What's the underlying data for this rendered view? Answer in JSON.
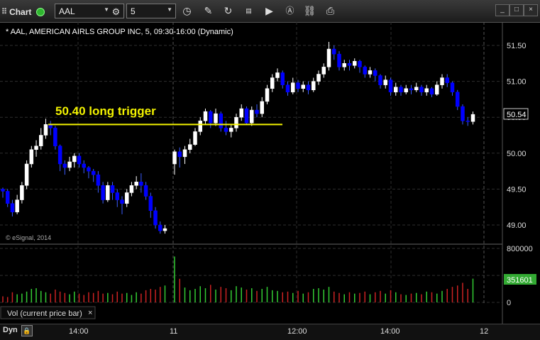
{
  "toolbar": {
    "title": "Chart",
    "symbol": "AAL",
    "interval": "5",
    "icons": [
      "clock-icon",
      "pencil-icon",
      "redraw-icon",
      "ticker-icon",
      "play-icon",
      "text-icon",
      "link-icon",
      "camera-icon"
    ],
    "window_buttons": [
      "minimize",
      "maximize",
      "close"
    ]
  },
  "chart": {
    "header": "* AAL, AMERICAN AIRLS GROUP INC, 5, 09:30-16:00 (Dynamic)",
    "watermark": "© eSignal, 2014",
    "annotation": "50.40 long trigger",
    "price_ticks": [
      "51.50",
      "51.00",
      "50.50",
      "50.00",
      "49.50",
      "49.00"
    ],
    "last_price": "50.54",
    "trigger_price": 50.4,
    "volume_ticks": [
      "800000",
      "400000",
      "0"
    ],
    "last_volume": "351601",
    "volume_label": "Vol (current price bar)",
    "close_symbol": "×",
    "colors": {
      "up": "#ffffff",
      "down": "#0000ff",
      "trigger": "#f2f200",
      "vol_up": "#33cc33",
      "vol_down": "#cc2222",
      "last_volume_bg": "#33aa33",
      "accent": "#555555"
    }
  },
  "chart_data": {
    "type": "candlestick",
    "x_tick_labels": [
      "14:00",
      "11",
      "12:00",
      "14:00",
      "12"
    ],
    "ylim": [
      48.82,
      51.73
    ],
    "volume_ylim": [
      0,
      800000
    ],
    "candles": [
      [
        49.5,
        49.47,
        49.52,
        49.38
      ],
      [
        49.47,
        49.3,
        49.5,
        49.25
      ],
      [
        49.3,
        49.18,
        49.35,
        49.12
      ],
      [
        49.18,
        49.35,
        49.42,
        49.15
      ],
      [
        49.35,
        49.55,
        49.6,
        49.3
      ],
      [
        49.55,
        49.85,
        49.9,
        49.5
      ],
      [
        49.85,
        50.05,
        50.1,
        49.8
      ],
      [
        50.05,
        50.1,
        50.18,
        49.95
      ],
      [
        50.1,
        50.25,
        50.35,
        50.05
      ],
      [
        50.25,
        50.4,
        50.48,
        50.2
      ],
      [
        50.4,
        50.35,
        50.45,
        50.25
      ],
      [
        50.35,
        50.1,
        50.38,
        50.05
      ],
      [
        50.1,
        49.85,
        50.12,
        49.75
      ],
      [
        49.85,
        49.8,
        49.9,
        49.7
      ],
      [
        49.8,
        49.88,
        49.95,
        49.75
      ],
      [
        49.88,
        49.96,
        50.0,
        49.8
      ],
      [
        49.96,
        49.85,
        50.0,
        49.8
      ],
      [
        49.85,
        49.8,
        49.9,
        49.72
      ],
      [
        49.8,
        49.75,
        49.82,
        49.65
      ],
      [
        49.75,
        49.7,
        49.78,
        49.6
      ],
      [
        49.7,
        49.55,
        49.75,
        49.45
      ],
      [
        49.55,
        49.35,
        49.6,
        49.3
      ],
      [
        49.35,
        49.55,
        49.6,
        49.32
      ],
      [
        49.55,
        49.45,
        49.6,
        49.35
      ],
      [
        49.45,
        49.35,
        49.5,
        49.25
      ],
      [
        49.35,
        49.3,
        49.4,
        49.15
      ],
      [
        49.3,
        49.45,
        49.5,
        49.25
      ],
      [
        49.45,
        49.55,
        49.6,
        49.4
      ],
      [
        49.55,
        49.6,
        49.68,
        49.5
      ],
      [
        49.6,
        49.55,
        49.72,
        49.45
      ],
      [
        49.55,
        49.4,
        49.6,
        49.35
      ],
      [
        49.4,
        49.2,
        49.45,
        49.1
      ],
      [
        49.2,
        49.0,
        49.25,
        48.95
      ],
      [
        49.0,
        48.92,
        49.05,
        48.88
      ],
      [
        48.92,
        48.95,
        49.0,
        48.88
      ],
      [
        49.85,
        50.02,
        50.05,
        49.7
      ],
      [
        50.02,
        49.95,
        50.08,
        49.8
      ],
      [
        49.95,
        50.05,
        50.1,
        49.85
      ],
      [
        50.05,
        50.12,
        50.2,
        50.0
      ],
      [
        50.12,
        50.3,
        50.35,
        50.1
      ],
      [
        50.3,
        50.45,
        50.5,
        50.25
      ],
      [
        50.45,
        50.58,
        50.62,
        50.4
      ],
      [
        50.58,
        50.42,
        50.6,
        50.35
      ],
      [
        50.42,
        50.55,
        50.62,
        50.38
      ],
      [
        50.55,
        50.35,
        50.58,
        50.3
      ],
      [
        50.35,
        50.3,
        50.45,
        50.25
      ],
      [
        50.3,
        50.35,
        50.4,
        50.22
      ],
      [
        50.35,
        50.5,
        50.55,
        50.3
      ],
      [
        50.5,
        50.62,
        50.68,
        50.45
      ],
      [
        50.62,
        50.42,
        50.65,
        50.4
      ],
      [
        50.42,
        50.6,
        50.65,
        50.38
      ],
      [
        50.6,
        50.55,
        50.68,
        50.5
      ],
      [
        50.55,
        50.72,
        50.78,
        50.5
      ],
      [
        50.72,
        50.9,
        50.95,
        50.68
      ],
      [
        50.9,
        51.05,
        51.1,
        50.85
      ],
      [
        51.05,
        51.12,
        51.18,
        51.0
      ],
      [
        51.12,
        50.95,
        51.15,
        50.9
      ],
      [
        50.95,
        50.85,
        51.0,
        50.8
      ],
      [
        50.85,
        50.98,
        51.05,
        50.82
      ],
      [
        50.98,
        50.9,
        51.02,
        50.85
      ],
      [
        50.9,
        50.95,
        51.0,
        50.85
      ],
      [
        50.95,
        50.88,
        51.0,
        50.82
      ],
      [
        50.88,
        51.0,
        51.05,
        50.85
      ],
      [
        51.0,
        51.1,
        51.15,
        50.95
      ],
      [
        51.1,
        51.2,
        51.25,
        51.05
      ],
      [
        51.2,
        51.45,
        51.55,
        51.15
      ],
      [
        51.45,
        51.38,
        51.5,
        51.3
      ],
      [
        51.38,
        51.2,
        51.42,
        51.15
      ],
      [
        51.2,
        51.25,
        51.3,
        51.15
      ],
      [
        51.25,
        51.22,
        51.3,
        51.15
      ],
      [
        51.22,
        51.28,
        51.32,
        51.18
      ],
      [
        51.28,
        51.2,
        51.3,
        51.12
      ],
      [
        51.2,
        51.1,
        51.22,
        51.05
      ],
      [
        51.1,
        51.15,
        51.2,
        51.05
      ],
      [
        51.15,
        51.08,
        51.18,
        51.0
      ],
      [
        51.08,
        50.95,
        51.1,
        50.9
      ],
      [
        50.95,
        51.02,
        51.08,
        50.9
      ],
      [
        51.02,
        50.85,
        51.05,
        50.8
      ],
      [
        50.85,
        50.92,
        50.98,
        50.8
      ],
      [
        50.92,
        50.85,
        50.95,
        50.8
      ],
      [
        50.85,
        50.9,
        50.95,
        50.82
      ],
      [
        50.9,
        50.88,
        50.95,
        50.82
      ],
      [
        50.88,
        50.92,
        50.98,
        50.85
      ],
      [
        50.92,
        50.85,
        50.95,
        50.8
      ],
      [
        50.85,
        50.9,
        50.95,
        50.8
      ],
      [
        50.9,
        50.82,
        50.92,
        50.78
      ],
      [
        50.82,
        50.95,
        51.0,
        50.8
      ],
      [
        50.95,
        51.05,
        51.1,
        50.9
      ],
      [
        51.05,
        50.98,
        51.1,
        50.92
      ],
      [
        50.98,
        50.85,
        51.0,
        50.8
      ],
      [
        50.85,
        50.65,
        50.88,
        50.6
      ],
      [
        50.65,
        50.45,
        50.68,
        50.4
      ],
      [
        50.45,
        50.44,
        50.5,
        50.38
      ],
      [
        50.44,
        50.54,
        50.58,
        50.4
      ]
    ],
    "volumes": [
      90000,
      80000,
      150000,
      120000,
      130000,
      160000,
      200000,
      210000,
      170000,
      150000,
      130000,
      190000,
      160000,
      140000,
      120000,
      160000,
      130000,
      110000,
      150000,
      140000,
      170000,
      130000,
      140000,
      120000,
      160000,
      130000,
      140000,
      110000,
      150000,
      130000,
      180000,
      200000,
      190000,
      230000,
      250000,
      680000,
      350000,
      220000,
      180000,
      200000,
      240000,
      210000,
      260000,
      190000,
      230000,
      210000,
      180000,
      240000,
      220000,
      190000,
      210000,
      170000,
      200000,
      230000,
      180000,
      170000,
      150000,
      160000,
      140000,
      170000,
      130000,
      150000,
      200000,
      210000,
      190000,
      230000,
      160000,
      140000,
      120000,
      150000,
      130000,
      140000,
      160000,
      120000,
      150000,
      170000,
      130000,
      180000,
      150000,
      120000,
      110000,
      130000,
      140000,
      120000,
      160000,
      150000,
      130000,
      170000,
      200000,
      230000,
      250000,
      290000,
      200000,
      351601
    ],
    "up_colors_note": "up candles hollow white, down candles blue"
  }
}
